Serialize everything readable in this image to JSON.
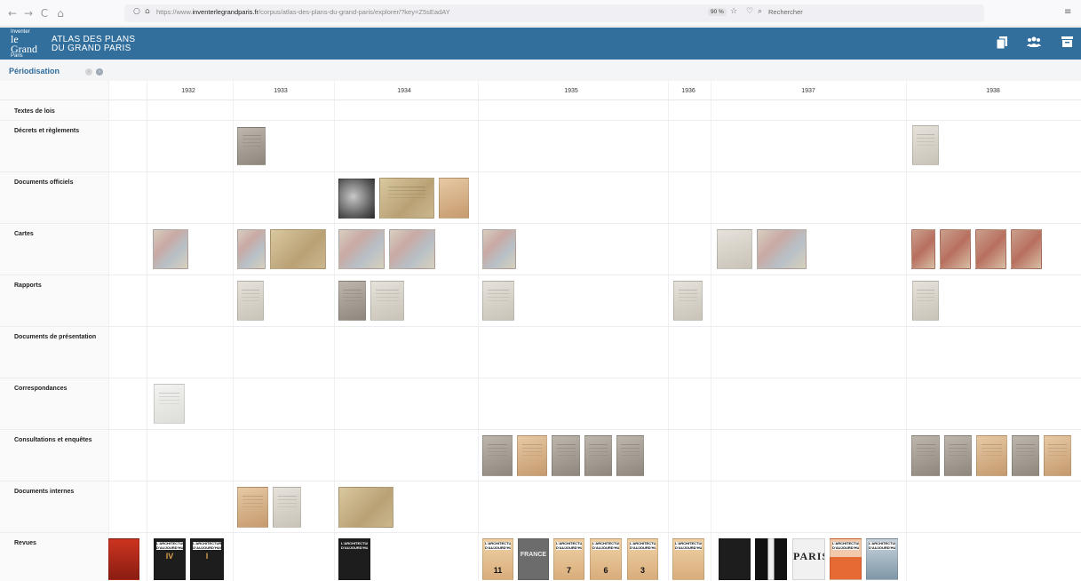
{
  "browser": {
    "back": "←",
    "forward": "→",
    "reload": "C",
    "home": "⌂",
    "url_prefix": "https://www.",
    "url_domain": "inventerlegrandparis.fr",
    "url_path": "/corpus/atlas-des-plans-du-grand-paris/explorer/?key=Z5sEadAY",
    "zoom": "90 %",
    "search_placeholder": "Rechercher",
    "menu": "≡"
  },
  "header": {
    "logo_line1": "Inventer",
    "logo_line2": "le Grand",
    "logo_line3": "Paris",
    "title_line1": "ATLAS DES PLANS",
    "title_line2": "DU GRAND PARIS",
    "icon_copy": "copy-icon",
    "icon_users": "users-icon",
    "icon_archive": "archive-icon"
  },
  "toolbar": {
    "section_title": "Périodisation",
    "prev_btn": "‹",
    "next_btn": "›"
  },
  "timeline": {
    "years": [
      "1932",
      "1933",
      "1934",
      "1935",
      "1936",
      "1937",
      "1938"
    ],
    "categories": [
      "Textes de lois",
      "Décrets et règlements",
      "Documents officiels",
      "Cartes",
      "Rapports",
      "Documents de présentation",
      "Correspondances",
      "Consultations et enquêtes",
      "Documents internes",
      "Revues"
    ]
  },
  "magazines": {
    "aa": "L'ARCHITECTURE D'AUJOURD'HUI",
    "issue_iv": "IV",
    "issue_i": "I",
    "france": "FRANCE",
    "paris": "PARIS",
    "n11": "11",
    "n7": "7",
    "n6": "6",
    "n3": "3"
  }
}
